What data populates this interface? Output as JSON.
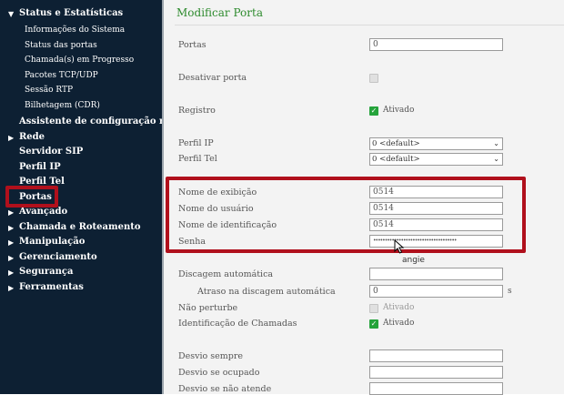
{
  "sidebar": {
    "items": [
      {
        "label": "Status e Estatísticas",
        "type": "group-open"
      },
      {
        "label": "Informações do Sistema",
        "type": "sub"
      },
      {
        "label": "Status das portas",
        "type": "sub"
      },
      {
        "label": "Chamada(s) em Progresso",
        "type": "sub"
      },
      {
        "label": "Pacotes TCP/UDP",
        "type": "sub"
      },
      {
        "label": "Sessão RTP",
        "type": "sub"
      },
      {
        "label": "Bilhetagem (CDR)",
        "type": "sub"
      },
      {
        "label": "Assistente de configuração rápida",
        "type": "item"
      },
      {
        "label": "Rede",
        "type": "group"
      },
      {
        "label": "Servidor SIP",
        "type": "item"
      },
      {
        "label": "Perfil IP",
        "type": "item"
      },
      {
        "label": "Perfil Tel",
        "type": "item"
      },
      {
        "label": "Portas",
        "type": "item-active"
      },
      {
        "label": "Avançado",
        "type": "group"
      },
      {
        "label": "Chamada e Roteamento",
        "type": "group"
      },
      {
        "label": "Manipulação",
        "type": "group"
      },
      {
        "label": "Gerenciamento",
        "type": "group"
      },
      {
        "label": "Segurança",
        "type": "group"
      },
      {
        "label": "Ferramentas",
        "type": "group"
      }
    ]
  },
  "main": {
    "title": "Modificar Porta",
    "fields": {
      "portas": {
        "label": "Portas",
        "value": "0"
      },
      "desativar": {
        "label": "Desativar porta"
      },
      "registro": {
        "label": "Registro",
        "check_label": "Ativado"
      },
      "perfil_ip": {
        "label": "Perfil IP",
        "value": "0 <default>"
      },
      "perfil_tel": {
        "label": "Perfil Tel",
        "value": "0 <default>"
      },
      "nome_exibicao": {
        "label": "Nome de exibição",
        "value": "0514"
      },
      "nome_usuario": {
        "label": "Nome do usuário",
        "value": "0514"
      },
      "nome_identificacao": {
        "label": "Nome de identificação",
        "value": "0514"
      },
      "senha": {
        "label": "Senha",
        "value": "••••••••••••••••••••••••••••••••••••"
      },
      "discagem_auto": {
        "label": "Discagem automática",
        "value": ""
      },
      "atraso_discagem": {
        "label": "Atraso na discagem automática",
        "value": "0",
        "unit": "s"
      },
      "nao_perturbe": {
        "label": "Não perturbe",
        "check_label": "Ativado"
      },
      "identificacao_chamadas": {
        "label": "Identificação de Chamadas",
        "check_label": "Ativado"
      },
      "desvio_sempre": {
        "label": "Desvio sempre",
        "value": ""
      },
      "desvio_ocupado": {
        "label": "Desvio se ocupado",
        "value": ""
      },
      "desvio_nao_atende": {
        "label": "Desvio se não atende",
        "value": ""
      }
    }
  },
  "cursor_label": "angie",
  "colors": {
    "sidebar_bg": "#0d2033",
    "accent_green": "#2e8b2e",
    "check_green": "#25a33b",
    "highlight_red": "#b0101c",
    "content_bg": "#f3f3f3"
  }
}
